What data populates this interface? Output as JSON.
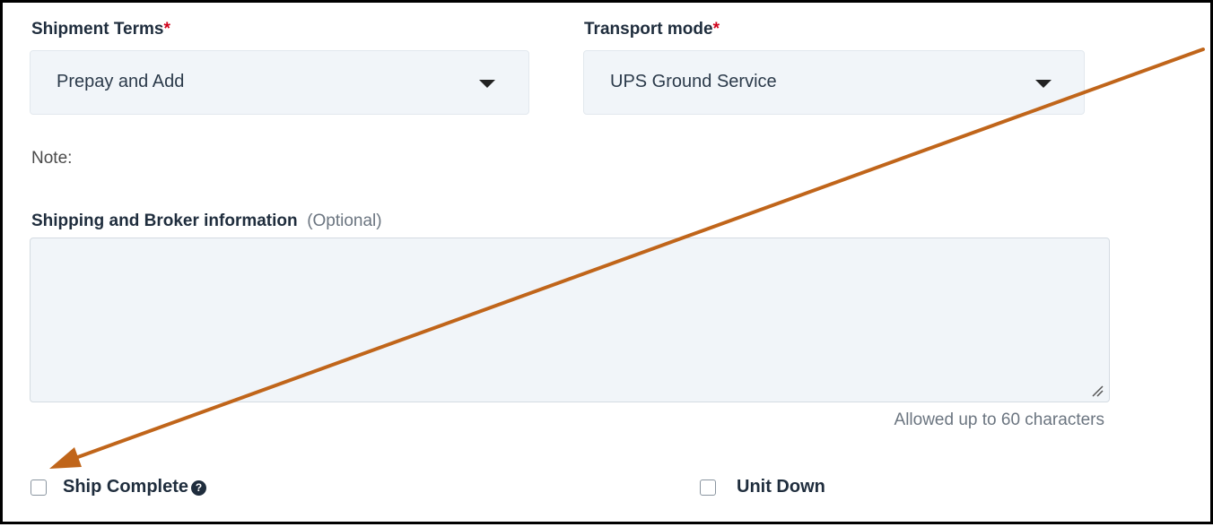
{
  "shipment_terms": {
    "label": "Shipment Terms",
    "required_mark": "*",
    "selected": "Prepay and Add"
  },
  "transport_mode": {
    "label": "Transport mode",
    "required_mark": "*",
    "selected": "UPS Ground Service"
  },
  "note_label": "Note:",
  "broker_info": {
    "label": "Shipping and Broker information",
    "optional": "(Optional)",
    "value": "",
    "hint": "Allowed up to 60 characters"
  },
  "ship_complete": {
    "label": "Ship Complete",
    "help_glyph": "?",
    "checked": false
  },
  "unit_down": {
    "label": "Unit Down",
    "checked": false
  },
  "colors": {
    "annotation_arrow": "#c0651a",
    "required_star": "#d0021b",
    "field_background": "#f1f5f9"
  },
  "icons": [
    "caret-down-icon",
    "help-circle-icon",
    "resize-grip-icon",
    "annotation-arrow"
  ]
}
